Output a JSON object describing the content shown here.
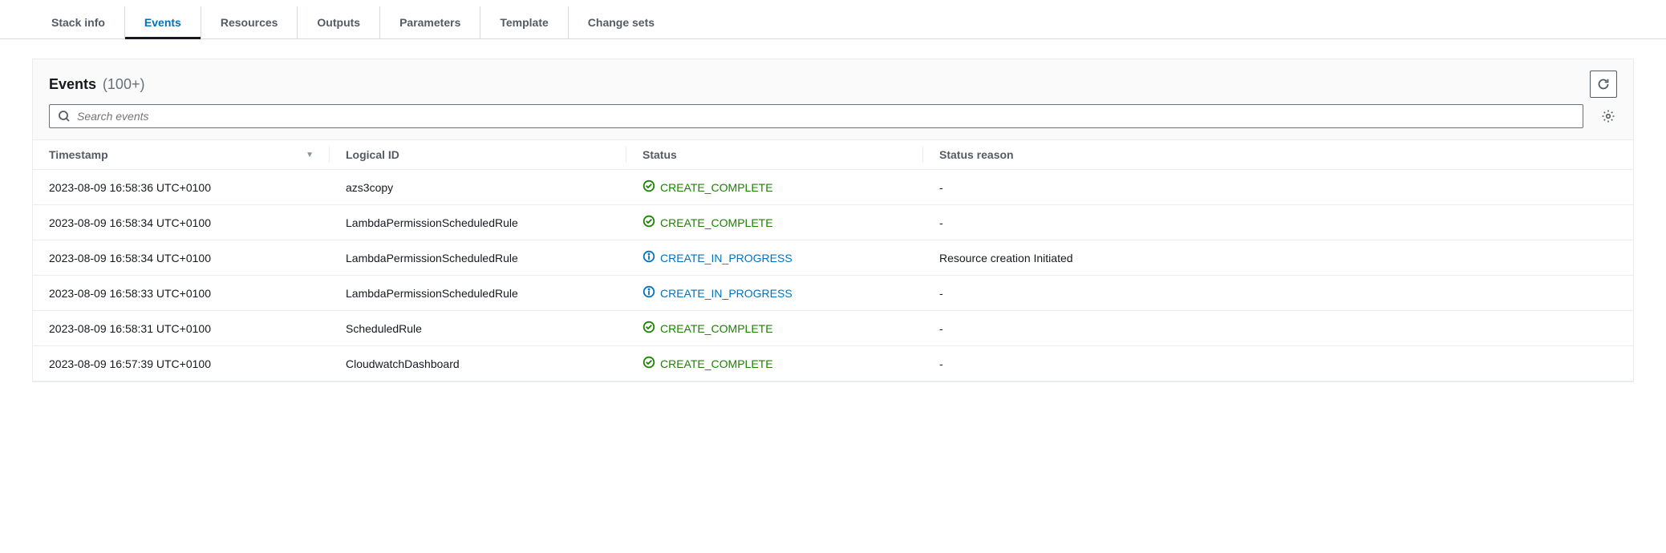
{
  "tabs": [
    {
      "label": "Stack info",
      "active": false
    },
    {
      "label": "Events",
      "active": true
    },
    {
      "label": "Resources",
      "active": false
    },
    {
      "label": "Outputs",
      "active": false
    },
    {
      "label": "Parameters",
      "active": false
    },
    {
      "label": "Template",
      "active": false
    },
    {
      "label": "Change sets",
      "active": false
    }
  ],
  "panel": {
    "title": "Events",
    "count": "(100+)"
  },
  "search": {
    "placeholder": "Search events"
  },
  "columns": {
    "timestamp": "Timestamp",
    "logical_id": "Logical ID",
    "status": "Status",
    "status_reason": "Status reason"
  },
  "events": [
    {
      "timestamp": "2023-08-09 16:58:36 UTC+0100",
      "logical_id": "azs3copy",
      "status": "CREATE_COMPLETE",
      "status_type": "complete",
      "reason": "-"
    },
    {
      "timestamp": "2023-08-09 16:58:34 UTC+0100",
      "logical_id": "LambdaPermissionScheduledRule",
      "status": "CREATE_COMPLETE",
      "status_type": "complete",
      "reason": "-"
    },
    {
      "timestamp": "2023-08-09 16:58:34 UTC+0100",
      "logical_id": "LambdaPermissionScheduledRule",
      "status": "CREATE_IN_PROGRESS",
      "status_type": "progress",
      "reason": "Resource creation Initiated"
    },
    {
      "timestamp": "2023-08-09 16:58:33 UTC+0100",
      "logical_id": "LambdaPermissionScheduledRule",
      "status": "CREATE_IN_PROGRESS",
      "status_type": "progress",
      "reason": "-"
    },
    {
      "timestamp": "2023-08-09 16:58:31 UTC+0100",
      "logical_id": "ScheduledRule",
      "status": "CREATE_COMPLETE",
      "status_type": "complete",
      "reason": "-"
    },
    {
      "timestamp": "2023-08-09 16:57:39 UTC+0100",
      "logical_id": "CloudwatchDashboard",
      "status": "CREATE_COMPLETE",
      "status_type": "complete",
      "reason": "-"
    }
  ]
}
